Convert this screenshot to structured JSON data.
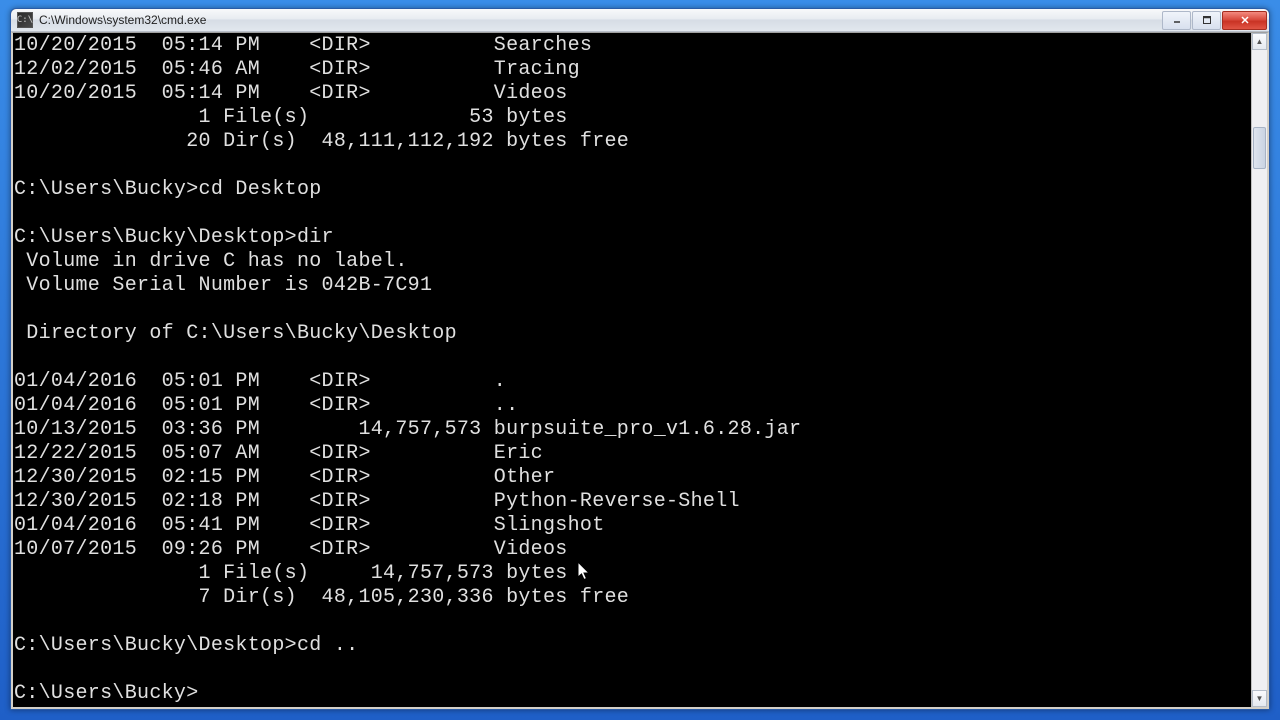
{
  "window": {
    "title": "C:\\Windows\\system32\\cmd.exe"
  },
  "terminal_lines": [
    "10/20/2015  05:14 PM    <DIR>          Searches",
    "12/02/2015  05:46 AM    <DIR>          Tracing",
    "10/20/2015  05:14 PM    <DIR>          Videos",
    "               1 File(s)             53 bytes",
    "              20 Dir(s)  48,111,112,192 bytes free",
    "",
    "C:\\Users\\Bucky>cd Desktop",
    "",
    "C:\\Users\\Bucky\\Desktop>dir",
    " Volume in drive C has no label.",
    " Volume Serial Number is 042B-7C91",
    "",
    " Directory of C:\\Users\\Bucky\\Desktop",
    "",
    "01/04/2016  05:01 PM    <DIR>          .",
    "01/04/2016  05:01 PM    <DIR>          ..",
    "10/13/2015  03:36 PM        14,757,573 burpsuite_pro_v1.6.28.jar",
    "12/22/2015  05:07 AM    <DIR>          Eric",
    "12/30/2015  02:15 PM    <DIR>          Other",
    "12/30/2015  02:18 PM    <DIR>          Python-Reverse-Shell",
    "01/04/2016  05:41 PM    <DIR>          Slingshot",
    "10/07/2015  09:26 PM    <DIR>          Videos",
    "               1 File(s)     14,757,573 bytes",
    "               7 Dir(s)  48,105,230,336 bytes free",
    "",
    "C:\\Users\\Bucky\\Desktop>cd ..",
    "",
    "C:\\Users\\Bucky>"
  ]
}
